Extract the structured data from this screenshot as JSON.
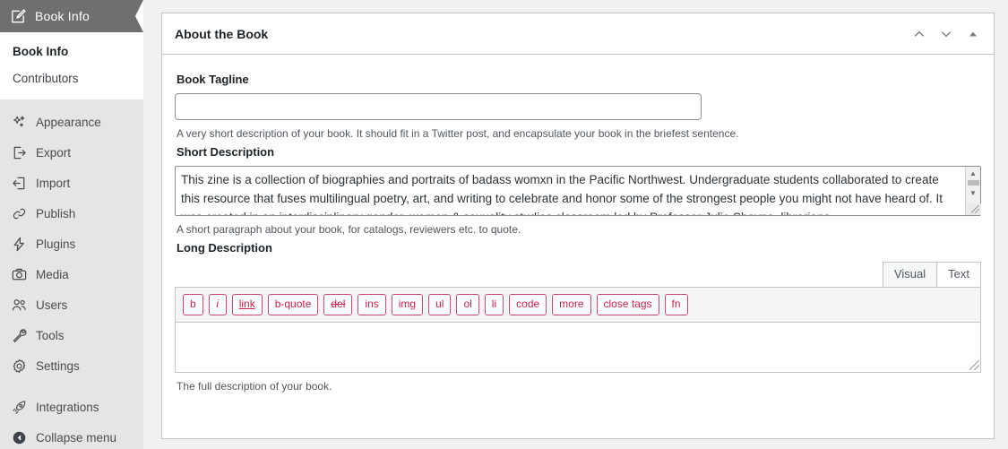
{
  "sidebar": {
    "active_menu": {
      "label": "Book Info",
      "icon": "edit-page-icon"
    },
    "submenu": [
      {
        "label": "Book Info",
        "current": true
      },
      {
        "label": "Contributors",
        "current": false
      }
    ],
    "items": [
      {
        "label": "Appearance",
        "icon": "appearance-icon"
      },
      {
        "label": "Export",
        "icon": "export-icon"
      },
      {
        "label": "Import",
        "icon": "import-icon"
      },
      {
        "label": "Publish",
        "icon": "publish-link-icon"
      },
      {
        "label": "Plugins",
        "icon": "plugins-plug-icon"
      },
      {
        "label": "Media",
        "icon": "media-camera-icon"
      },
      {
        "label": "Users",
        "icon": "users-icon"
      },
      {
        "label": "Tools",
        "icon": "tools-wrench-icon"
      },
      {
        "label": "Settings",
        "icon": "settings-gear-icon"
      }
    ],
    "items_secondary": [
      {
        "label": "Integrations",
        "icon": "integrations-rocket-icon"
      }
    ],
    "collapse": {
      "label": "Collapse menu",
      "icon": "collapse-arrow-icon"
    }
  },
  "panel": {
    "title": "About the Book",
    "header_actions": [
      {
        "name": "move-up",
        "icon": "chevron-up-icon"
      },
      {
        "name": "move-down",
        "icon": "chevron-down-icon"
      },
      {
        "name": "toggle-panel",
        "icon": "triangle-up-icon"
      }
    ]
  },
  "fields": {
    "tagline": {
      "label": "Book Tagline",
      "value": "",
      "placeholder": "",
      "help": "A very short description of your book. It should fit in a Twitter post, and encapsulate your book in the briefest sentence."
    },
    "short_description": {
      "label": "Short Description",
      "value": "This zine is a collection of biographies and portraits of badass womxn in the Pacific Northwest. Undergraduate students collaborated to create this resource that fuses multilingual poetry, art, and writing to celebrate and honor some of the strongest people you might not have heard of. It was created in an interdisciplinary gender, women & sexuality studies classroom led by Professor Julie Shayne, librarians",
      "help": "A short paragraph about your book, for catalogs, reviewers etc. to quote."
    },
    "long_description": {
      "label": "Long Description",
      "value": "",
      "help": "The full description of your book.",
      "tabs": [
        {
          "label": "Visual",
          "active": false
        },
        {
          "label": "Text",
          "active": true
        }
      ],
      "quicktags": [
        {
          "label": "b",
          "style": "bold"
        },
        {
          "label": "i",
          "style": "italic"
        },
        {
          "label": "link",
          "style": "underline"
        },
        {
          "label": "b-quote",
          "style": "normal"
        },
        {
          "label": "del",
          "style": "strikethrough"
        },
        {
          "label": "ins",
          "style": "normal"
        },
        {
          "label": "img",
          "style": "normal"
        },
        {
          "label": "ul",
          "style": "normal"
        },
        {
          "label": "ol",
          "style": "normal"
        },
        {
          "label": "li",
          "style": "normal"
        },
        {
          "label": "code",
          "style": "normal"
        },
        {
          "label": "more",
          "style": "normal"
        },
        {
          "label": "close tags",
          "style": "normal"
        },
        {
          "label": "fn",
          "style": "normal"
        }
      ]
    }
  },
  "colors": {
    "sidebar_bg": "#e5e5e5",
    "sidebar_active_bg": "#6f6f6f",
    "quicktag_accent": "#c9224d",
    "page_bg": "#f1f1f1",
    "panel_border": "#c3c4c7"
  }
}
